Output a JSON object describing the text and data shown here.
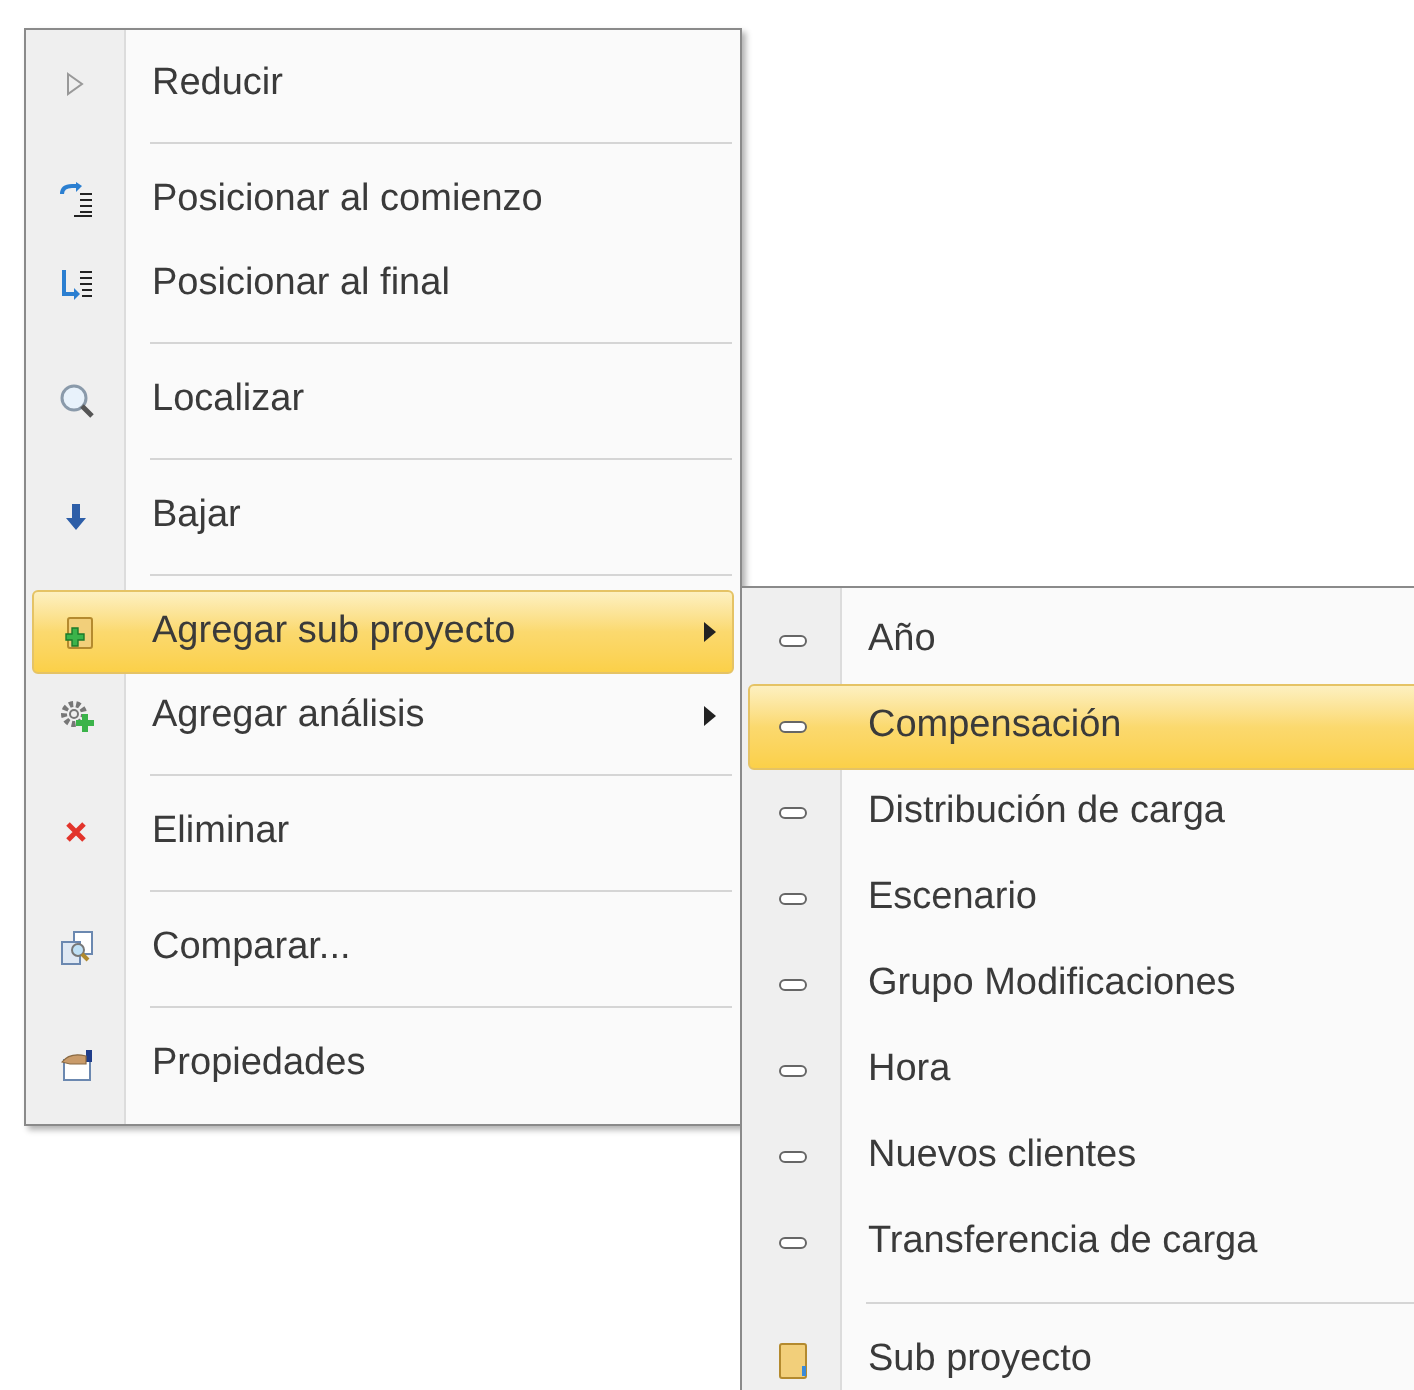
{
  "context_menu": {
    "items": [
      {
        "kind": "item",
        "label": "Reducir",
        "selected": false,
        "has_submenu": false
      },
      {
        "kind": "separator"
      },
      {
        "kind": "item",
        "label": "Posicionar al comienzo",
        "selected": false,
        "has_submenu": false
      },
      {
        "kind": "item",
        "label": "Posicionar al final",
        "selected": false,
        "has_submenu": false
      },
      {
        "kind": "separator"
      },
      {
        "kind": "item",
        "label": "Localizar",
        "selected": false,
        "has_submenu": false
      },
      {
        "kind": "separator"
      },
      {
        "kind": "item",
        "label": "Bajar",
        "selected": false,
        "has_submenu": false
      },
      {
        "kind": "separator"
      },
      {
        "kind": "item",
        "label": "Agregar sub proyecto",
        "selected": true,
        "has_submenu": true
      },
      {
        "kind": "item",
        "label": "Agregar análisis",
        "selected": false,
        "has_submenu": true
      },
      {
        "kind": "separator"
      },
      {
        "kind": "item",
        "label": "Eliminar",
        "selected": false,
        "has_submenu": false
      },
      {
        "kind": "separator"
      },
      {
        "kind": "item",
        "label": "Comparar...",
        "selected": false,
        "has_submenu": false
      },
      {
        "kind": "separator"
      },
      {
        "kind": "item",
        "label": "Propiedades",
        "selected": false,
        "has_submenu": false
      }
    ]
  },
  "submenu": {
    "items": [
      {
        "kind": "category",
        "label": "Año",
        "selected": false
      },
      {
        "kind": "category",
        "label": "Compensación",
        "selected": true
      },
      {
        "kind": "category",
        "label": "Distribución de carga",
        "selected": false
      },
      {
        "kind": "category",
        "label": "Escenario",
        "selected": false
      },
      {
        "kind": "category",
        "label": "Grupo Modificaciones",
        "selected": false
      },
      {
        "kind": "category",
        "label": "Hora",
        "selected": false
      },
      {
        "kind": "category",
        "label": "Nuevos clientes",
        "selected": false
      },
      {
        "kind": "category",
        "label": "Transferencia de carga",
        "selected": false
      },
      {
        "kind": "separator"
      },
      {
        "kind": "subproject",
        "label": "Sub proyecto",
        "selected": false
      }
    ]
  }
}
